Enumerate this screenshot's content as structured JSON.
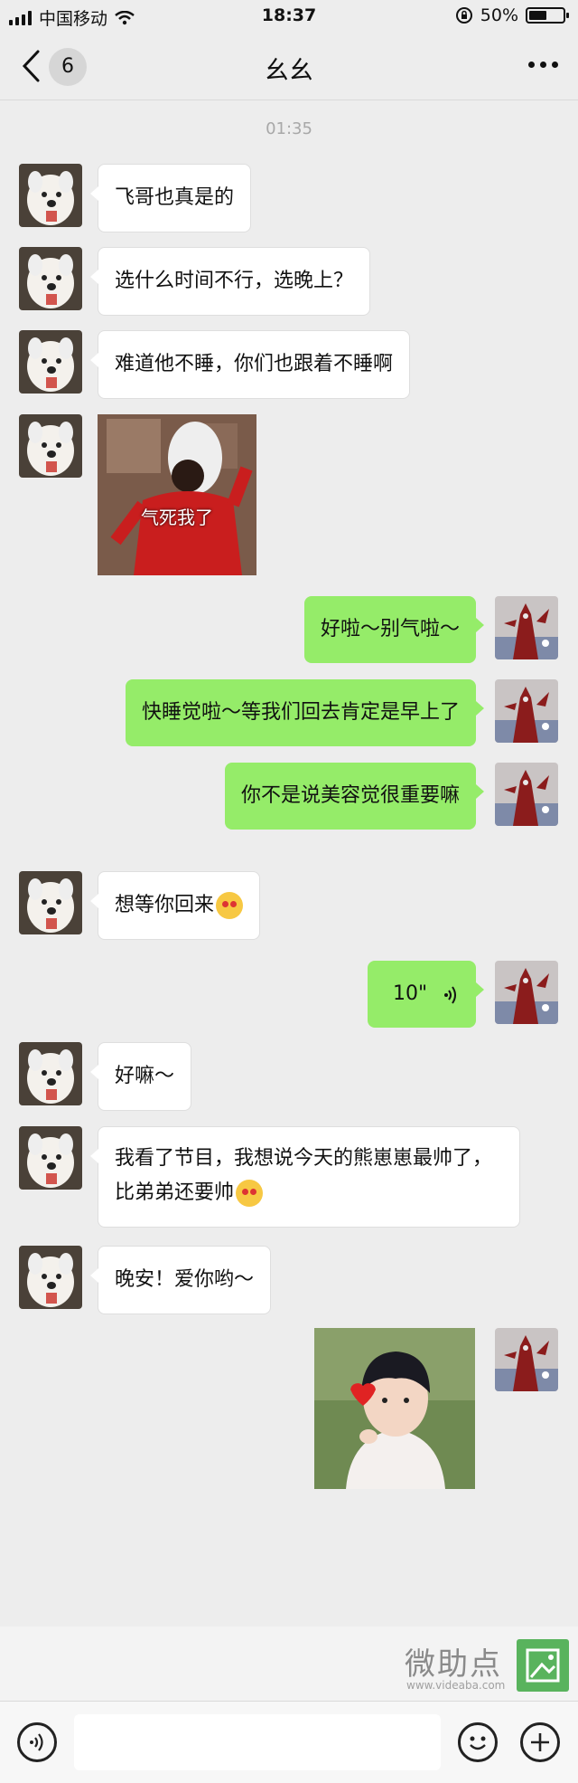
{
  "status_bar": {
    "carrier": "中国移动",
    "time": "18:37",
    "battery": "50%"
  },
  "nav": {
    "unread_count": "6",
    "title": "幺幺"
  },
  "chat": {
    "timestamp": "01:35",
    "messages": [
      {
        "text": "飞哥也真是的"
      },
      {
        "text": "选什么时间不行，选晚上？"
      },
      {
        "text": "难道他不睡，你们也跟着不睡啊"
      },
      {
        "sticker_caption": "气死我了"
      },
      {
        "text": "好啦～别气啦～"
      },
      {
        "text": "快睡觉啦～等我们回去肯定是早上了"
      },
      {
        "text": "你不是说美容觉很重要嘛"
      },
      {
        "text": "想等你回来"
      },
      {
        "voice_duration": "10\""
      },
      {
        "text": "好嘛～"
      },
      {
        "text": "我看了节目，我想说今天的熊崽崽最帅了，比弟弟还要帅"
      },
      {
        "text": "晚安！爱你哟～"
      }
    ]
  },
  "watermark": {
    "text": "微助点",
    "url": "www.videaba.com"
  },
  "colors": {
    "outgoing_bubble": "#95ec69",
    "incoming_bubble": "#ffffff",
    "background": "#ededed"
  }
}
